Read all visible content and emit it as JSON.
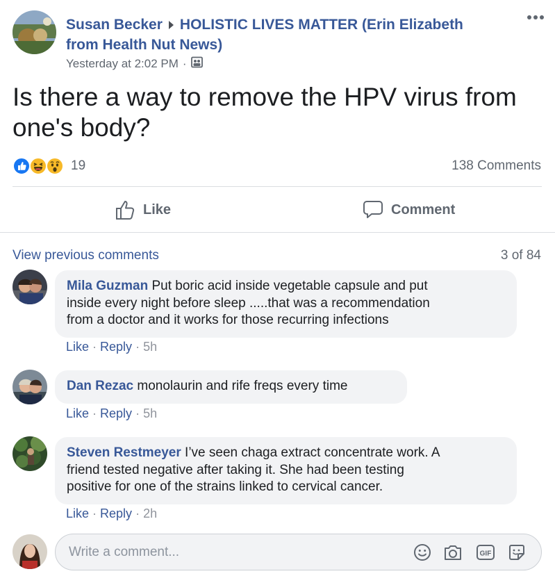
{
  "post": {
    "author": "Susan Becker",
    "group": "HOLISTIC LIVES MATTER (Erin Elizabeth",
    "group_line2": "from Health Nut News)",
    "time": "Yesterday at 2:02 PM",
    "separator": "·",
    "text_line1": "Is there a way to remove the HPV virus from",
    "text_line2": "one's body?",
    "reaction_count": "19",
    "comments_count": "138 Comments"
  },
  "actions": {
    "like": "Like",
    "comment": "Comment"
  },
  "comments_header": {
    "view_previous": "View previous comments",
    "pager": "3 of 84"
  },
  "comments": [
    {
      "name": "Mila Guzman",
      "text_line1": "Put boric acid inside vegetable capsule and put",
      "text_line2": "inside every night before sleep .....that was a recommendation",
      "text_line3": "from a doctor and it works for those recurring infections",
      "like": "Like",
      "reply": "Reply",
      "time": "5h"
    },
    {
      "name": "Dan Rezac",
      "text_line1": "monolaurin and rife freqs every time",
      "like": "Like",
      "reply": "Reply",
      "time": "5h"
    },
    {
      "name": "Steven Restmeyer",
      "text_line1": "I’ve seen chaga extract concentrate work. A",
      "text_line2": "friend tested negative after taking it. She had been testing",
      "text_line3": "positive for one of the strains linked to cervical cancer.",
      "like": "Like",
      "reply": "Reply",
      "time": "2h"
    }
  ],
  "composer": {
    "placeholder": "Write a comment..."
  },
  "icons": {
    "more": "more-options-icon",
    "arrow": "arrow-right-icon",
    "audience": "group-audience-icon",
    "like_reaction": "like-reaction-icon",
    "haha_reaction": "haha-reaction-icon",
    "wow_reaction": "wow-reaction-icon",
    "thumb": "thumbs-up-icon",
    "speech": "speech-bubble-icon",
    "emoji": "emoji-icon",
    "camera": "camera-icon",
    "gif": "gif-icon",
    "sticker": "sticker-icon"
  },
  "colors": {
    "link": "#385898",
    "muted": "#606770",
    "bubble": "#f2f3f5",
    "like_blue": "#1877f2"
  }
}
